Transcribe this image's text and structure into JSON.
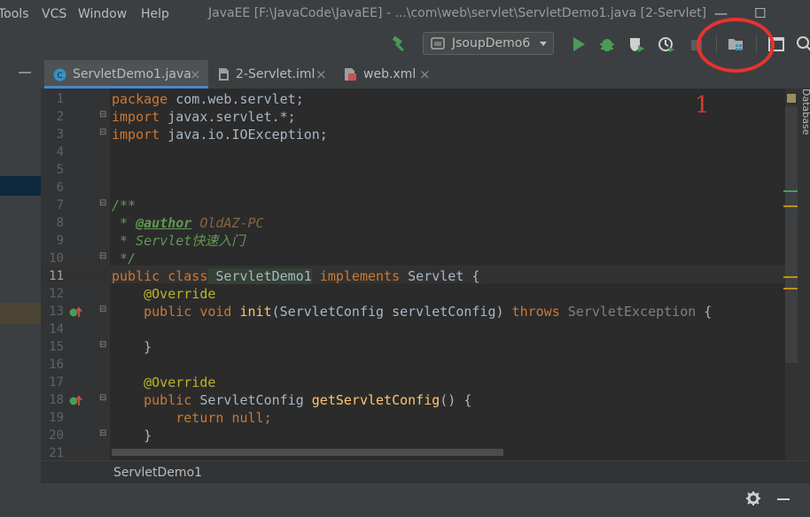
{
  "menu": [
    "Tools",
    "VCS",
    "Window",
    "Help"
  ],
  "window_title": "JavaEE [F:\\JavaCode\\JavaEE] - ...\\com\\web\\servlet\\ServletDemo1.java [2-Servlet]",
  "window_controls": {
    "minimize": "—",
    "maximize": "☐"
  },
  "toolbar": {
    "run_config": "JsoupDemo6",
    "icons": [
      "hammer-icon",
      "run-icon",
      "debug-icon",
      "coverage-icon",
      "profile-icon",
      "stop-icon",
      "project-structure-icon",
      "layout-icon",
      "search-icon"
    ]
  },
  "tabs": [
    {
      "label": "ServletDemo1.java",
      "icon": "java-class-icon",
      "active": true
    },
    {
      "label": "2-Servlet.iml",
      "icon": "iml-file-icon",
      "active": false
    },
    {
      "label": "web.xml",
      "icon": "xml-file-icon",
      "active": false
    }
  ],
  "tab_close": "×",
  "editor": {
    "line_numbers": [
      "1",
      "2",
      "3",
      "4",
      "5",
      "6",
      "7",
      "8",
      "9",
      "10",
      "11",
      "12",
      "13",
      "14",
      "15",
      "16",
      "17",
      "18",
      "19",
      "20",
      "21"
    ],
    "code": {
      "l1_kw": "package",
      "l1_rest": " com.web.servlet;",
      "l2_kw": "import",
      "l2_rest": " javax.servlet.*;",
      "l3_kw": "import",
      "l3_rest": " java.io.IOException;",
      "l7": "/**",
      "l8_pre": " * ",
      "l8_tag": "@author",
      "l8_val": " OldAZ-PC",
      "l9": " * Servlet快速入门",
      "l10": " */",
      "l11_kw1": "public class",
      "l11_name": " ServletDemo1",
      "l11_kw2": " implements",
      "l11_rest": " Servlet {",
      "l12": "    @Override",
      "l13_kw": "    public void",
      "l13_meth": " init",
      "l13_params": "(ServletConfig servletConfig)",
      "l13_throws": " throws",
      "l13_exc": " ServletException",
      "l13_end": " {",
      "l15": "    }",
      "l17": "    @Override",
      "l18_kw": "    public",
      "l18_type": " ServletConfig",
      "l18_meth": " getServletConfig",
      "l18_end": "() {",
      "l19_kw": "        return null",
      "l19_end": ";",
      "l20": "    }"
    }
  },
  "right_strip_label": "Database",
  "breadcrumb": "ServletDemo1",
  "annotation_number": "1",
  "colors": {
    "accent_run": "#499c54",
    "annotation": "#e8322f"
  }
}
